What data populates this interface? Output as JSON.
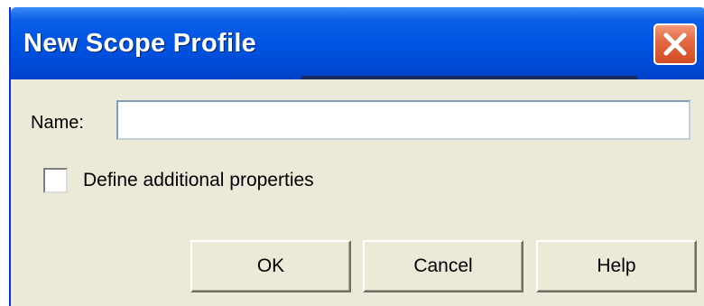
{
  "window": {
    "title": "New Scope Profile",
    "close_icon": "close-x-icon"
  },
  "form": {
    "name_label": "Name:",
    "name_value": "",
    "checkbox_label": "Define additional properties",
    "checkbox_checked": false
  },
  "buttons": {
    "ok": "OK",
    "cancel": "Cancel",
    "help": "Help"
  },
  "colors": {
    "titlebar": "#0054e3",
    "close_button": "#e46a45",
    "dialog_background": "#ece9d8"
  }
}
